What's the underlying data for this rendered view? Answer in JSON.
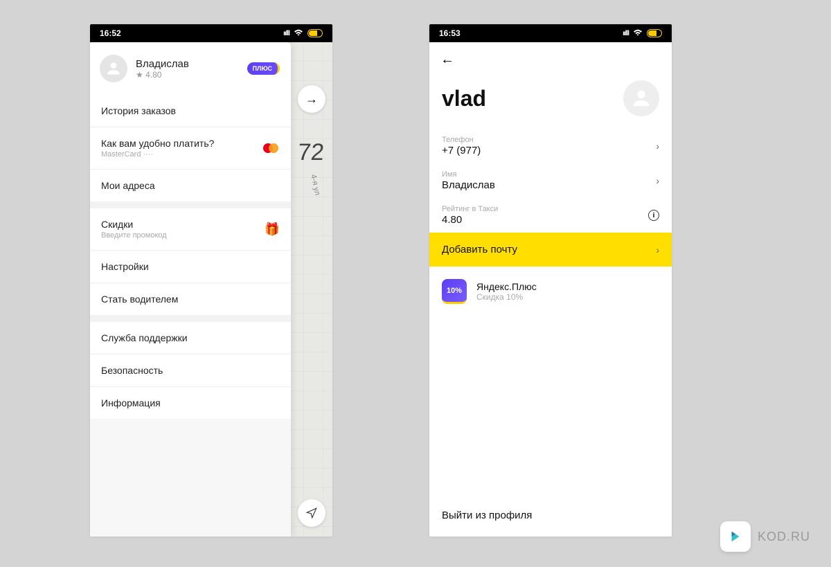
{
  "left": {
    "status_time": "16:52",
    "battery": "63",
    "profile": {
      "name": "Владислав",
      "rating": "★ 4.80",
      "badge": "ПЛЮС"
    },
    "map": {
      "big_label": "72",
      "street": "4-я ул"
    },
    "group1": {
      "history": "История заказов",
      "pay_title": "Как вам удобно платить?",
      "pay_sub": "MasterCard ····",
      "addresses": "Мои адреса"
    },
    "group2": {
      "discounts_title": "Скидки",
      "discounts_sub": "Введите промокод",
      "settings": "Настройки",
      "driver": "Стать водителем"
    },
    "group3": {
      "support": "Служба поддержки",
      "safety": "Безопасность",
      "info": "Информация"
    }
  },
  "right": {
    "status_time": "16:53",
    "battery": "63",
    "title": "vlad",
    "phone": {
      "label": "Телефон",
      "value": "+7 (977)"
    },
    "name": {
      "label": "Имя",
      "value": "Владислав"
    },
    "rating": {
      "label": "Рейтинг в Такси",
      "value": "4.80"
    },
    "add_email": "Добавить почту",
    "plus": {
      "tile": "10%",
      "title": "Яндекс.Плюс",
      "sub": "Скидка 10%"
    },
    "logout": "Выйти из профиля"
  },
  "watermark": "KOD.RU"
}
